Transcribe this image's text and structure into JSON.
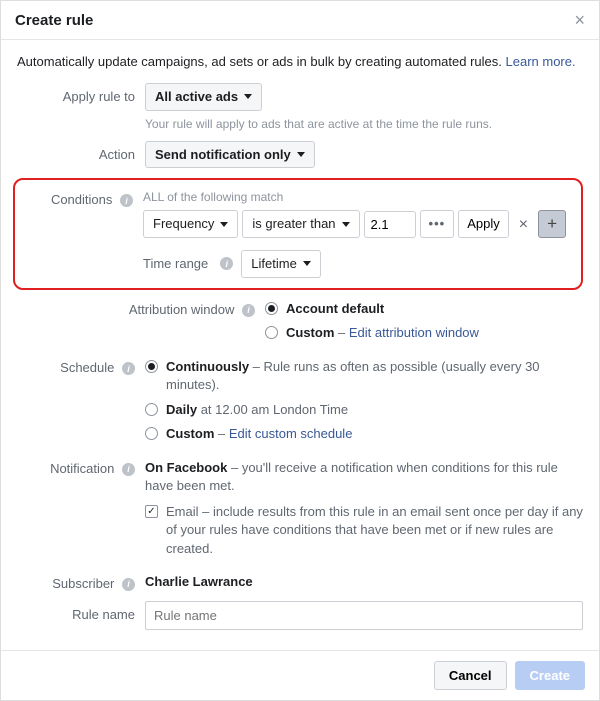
{
  "header": {
    "title": "Create rule"
  },
  "intro": {
    "text": "Automatically update campaigns, ad sets or ads in bulk by creating automated rules.",
    "learn_more": "Learn more."
  },
  "apply": {
    "label": "Apply rule to",
    "value": "All active ads",
    "helper": "Your rule will apply to ads that are active at the time the rule runs."
  },
  "action": {
    "label": "Action",
    "value": "Send notification only"
  },
  "conditions": {
    "label": "Conditions",
    "header": "ALL of the following match",
    "field": "Frequency",
    "operator": "is greater than",
    "value": "2.1",
    "apply_btn": "Apply",
    "time_range_label": "Time range",
    "time_range_value": "Lifetime"
  },
  "attribution": {
    "label": "Attribution window",
    "opt1": "Account default",
    "opt2": "Custom",
    "edit_link": "Edit attribution window"
  },
  "schedule": {
    "label": "Schedule",
    "opt1_title": "Continuously",
    "opt1_desc": " – Rule runs as often as possible (usually every 30 minutes).",
    "opt2_title": "Daily",
    "opt2_desc": " at 12.00 am London Time",
    "opt3_title": "Custom",
    "opt3_link": "Edit custom schedule"
  },
  "notification": {
    "label": "Notification",
    "title": "On Facebook",
    "desc": " – you'll receive a notification when conditions for this rule have been met.",
    "email_label": "Email",
    "email_desc": " – include results from this rule in an email sent once per day if any of your rules have conditions that have been met or if new rules are created."
  },
  "subscriber": {
    "label": "Subscriber",
    "value": "Charlie Lawrance"
  },
  "rulename": {
    "label": "Rule name",
    "placeholder": "Rule name"
  },
  "footer": {
    "cancel": "Cancel",
    "create": "Create"
  }
}
